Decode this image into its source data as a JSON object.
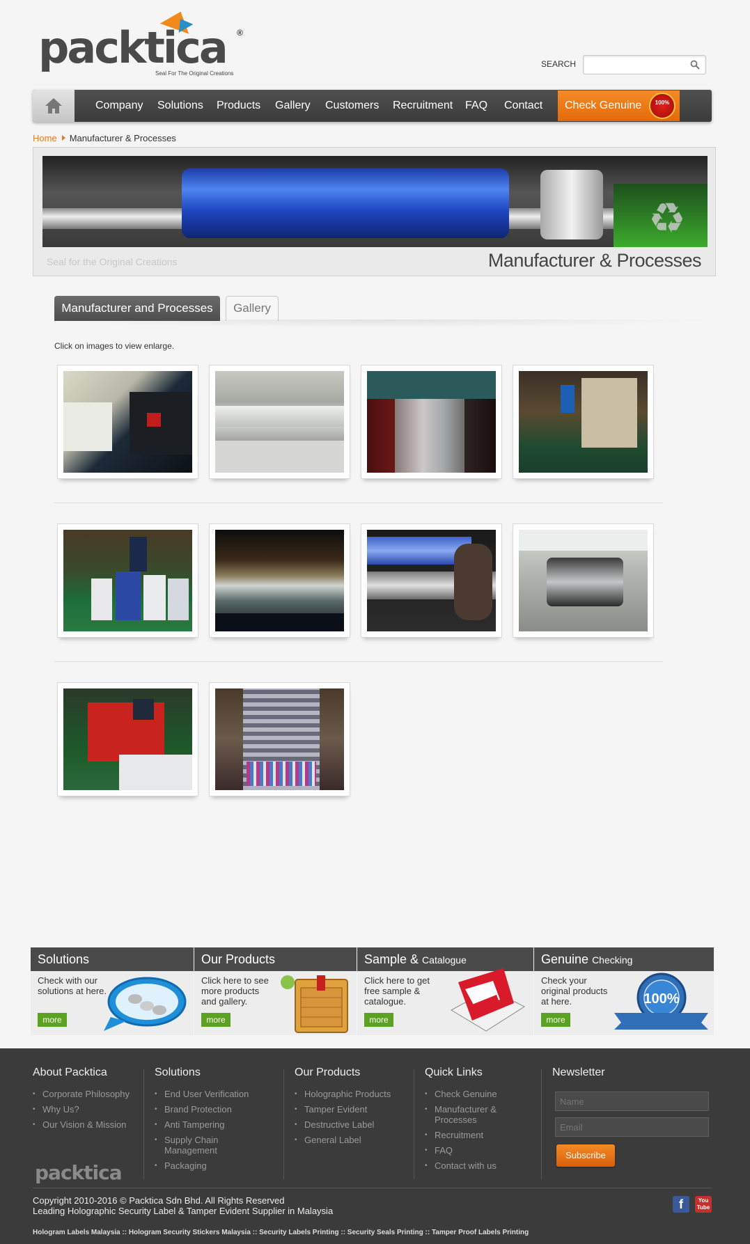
{
  "header": {
    "logo_text": "packtica",
    "logo_reg": "®",
    "logo_tagline": "Seal For The Original Creations",
    "search_label": "SEARCH",
    "search_placeholder": ""
  },
  "nav": {
    "items": [
      "Company",
      "Solutions",
      "Products",
      "Gallery",
      "Customers",
      "Recruitment",
      "FAQ",
      "Contact"
    ],
    "check_genuine": "Check Genuine",
    "seal_text": "100%"
  },
  "breadcrumb": {
    "home": "Home",
    "current": "Manufacturer & Processes"
  },
  "banner": {
    "tagline": "Seal for the Original Creations",
    "title": "Manufacturer & Processes"
  },
  "tabs": {
    "active": "Manufacturer and Processes",
    "inactive": "Gallery"
  },
  "gallery": {
    "hint": "Click on images to view enlarge.",
    "photo_count": 10
  },
  "features": [
    {
      "title": "Solutions",
      "title_small": "",
      "text": "Check with our solutions at here.",
      "more": "more"
    },
    {
      "title": "Our Products",
      "title_small": "",
      "text": "Click here to see more products and gallery.",
      "more": "more"
    },
    {
      "title": "Sample & ",
      "title_small": "Catalogue",
      "text": "Click here to get free sample & catalogue.",
      "more": "more"
    },
    {
      "title": "Genuine ",
      "title_small": "Checking",
      "text": "Check your original products at here.",
      "more": "more"
    }
  ],
  "footer": {
    "about": {
      "title": "About Packtica",
      "items": [
        "Corporate Philosophy",
        "Why Us?",
        "Our Vision & Mission"
      ]
    },
    "solutions": {
      "title": "Solutions",
      "items": [
        "End User Verification",
        "Brand Protection",
        "Anti Tampering",
        "Supply Chain Management",
        "Packaging"
      ]
    },
    "products": {
      "title": "Our Products",
      "items": [
        "Holographic Products",
        "Tamper Evident",
        "Destructive Label",
        "General Label"
      ]
    },
    "quick": {
      "title": "Quick Links",
      "items": [
        "Check Genuine",
        "Manufacturer & Processes",
        "Recruitment",
        "FAQ",
        "Contact with us"
      ]
    },
    "newsletter": {
      "title": "Newsletter",
      "name_placeholder": "Name",
      "email_placeholder": "Email",
      "subscribe": "Subscribe"
    },
    "logo": "packtica",
    "copyright": "Copyright 2010-2016 © Packtica Sdn Bhd. All Rights Reserved",
    "tagline": "Leading Holographic Security Label & Tamper Evident Supplier in Malaysia",
    "seo_links": "Hologram Labels Malaysia :: Hologram Security Stickers Malaysia :: Security Labels Printing :: Security Seals Printing :: Tamper Proof Labels Printing",
    "facebook": "f",
    "youtube": "You Tube"
  },
  "colors": {
    "accent": "#e8761a",
    "nav_bg": "#444444",
    "more_green": "#5ba222",
    "footer_bg": "#3b3b3b"
  }
}
